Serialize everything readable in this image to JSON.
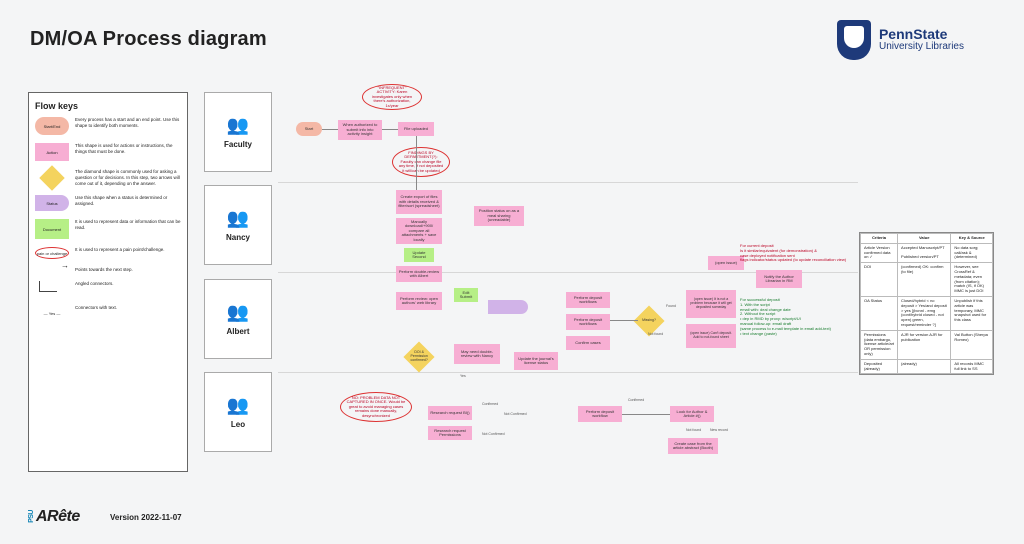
{
  "title": "DM/OA Process diagram",
  "brand": {
    "name": "PennState",
    "sub": "University Libraries"
  },
  "footer": {
    "logo_small": "PSU",
    "logo": "ARête",
    "version": "Version 2022-11-07"
  },
  "legend": {
    "title": "Flow keys",
    "items": [
      {
        "label": "Start/End",
        "desc": "Every process has a start and an end point. Use this shape to identify both moments."
      },
      {
        "label": "Action",
        "desc": "This shape is used for actions or instructions, the things that must be done."
      },
      {
        "label": "Decision",
        "desc": "The diamond shape is commonly used for asking a question or for decisions. In this step, two arrows will come out of it, depending on the answer."
      },
      {
        "label": "Status",
        "desc": "Use this shape when a status is determined or assigned."
      },
      {
        "label": "Document",
        "desc": "It is used to represent data or information that can be read."
      },
      {
        "label": "pain or challenge",
        "desc": "It is used to represent a pain point/challenge."
      },
      {
        "label": "",
        "desc": "Points towards the next step."
      },
      {
        "label": "",
        "desc": "Angled connectors."
      },
      {
        "label": "",
        "desc": "Connectors with text."
      }
    ]
  },
  "lanes": [
    "Faculty",
    "Nancy",
    "Albert",
    "Leo"
  ],
  "nodes": {
    "start": "Start",
    "infrequent": "\"INFREQUENT\" ACTIVITY: Karen investigates only when there's authorization, 1x/year",
    "n1": "When authorized to submit info into activity insight",
    "n2": "File uploaded",
    "n3": "FINDINGS BY DEPARTMENT(?): Faculty can change file any time, if not deposited it will/can be updated",
    "n4": "Create export of files with details received & filter/sort (spreadsheet)",
    "n5": "Manually download/+900/ compare all attachments + save locally",
    "n6": "Update Second",
    "n7": "Perform double-review with Albert",
    "n8": "Position status on as a meal sharing (unreadable)",
    "n9": "Perform review: open authors' web library",
    "n10": "Edit Submit",
    "n11": "Perform deposit workflows",
    "n12": "Perform deposit workflows",
    "n13": "Confirm cases",
    "d1": "DOI & Permission confirmed?",
    "n14": "May need double-review with Nancy",
    "n15": "Update the journal's license status",
    "d2": "Missing?",
    "found": "Found",
    "notfound": "Not found",
    "n16": "(open issue) It is not a problem because it will get deposited someday",
    "n17": "(open issue) Can't deposit. Add to not-found sheet",
    "n18": "(open issue)",
    "n19": "Notify the Author Librarian in RM",
    "n20": "NO: PROBLEM DATA NOT CAPTURED IN ONCE. Would be great to avoid managing cases remains done manually, desynchronized",
    "n21": "Research request BI()",
    "n22": "Research request Permissions",
    "n23": "Perform deposit workflow",
    "n24": "Look for Author & Article #()",
    "n25": "Create case from the article abstract (Booth)",
    "conf": "Confirmed",
    "notconf": "Not Confirmed",
    "notconf2": "Not Confirmed",
    "conf2": "Confirmed",
    "yes": "Yes",
    "notfound3": "Not found",
    "new_record": "New record"
  },
  "side_notes": {
    "red1": "For current deposit\nIs it similar/equivalent (for demonstration) &\ncase deployed notification sent\nflags indicator/status updated (to update reconciliation view)",
    "green1": "For successful deposit\n1. With the script\n   email with: deal change date\n2. Without the script\n   • dep in RMD by proxy: w/script/UI\n   manual follow-up: email draft\n   (same process to e-mail template in email add-text)\n   • text change (paste)"
  },
  "table": {
    "headers": [
      "Criteria",
      "Value",
      "Key & Source"
    ],
    "rows": [
      [
        "Article Version confirmed data on ✓",
        "Accepted Manuscript/PT\n\nPublished version/PT",
        "No data sorg; call/ask & (determined)"
      ],
      [
        "DOI",
        "(confirmed) OK: confirm (to file)",
        "However, see CrossRef & metadata; even (from citation); match (IS, if OK) MMC is just DOI"
      ],
      [
        "OA Status",
        "Closed/hybrid < no deposit > Yes/and deposit > yes [(bcnnl - emg (cont/hybrid closed - not open) green, request/reminder ?]",
        "Unpublish if this article was temporary, MMC snapshot used for this class"
      ],
      [
        "Permissions (data embargo, license article/art OR permission only)",
        "AJR for version AJR for publication",
        "Val Button (Sherpa Romeo)"
      ],
      [
        "Deposited (already)",
        "(already)",
        "All records MMC full link to SS"
      ]
    ]
  }
}
